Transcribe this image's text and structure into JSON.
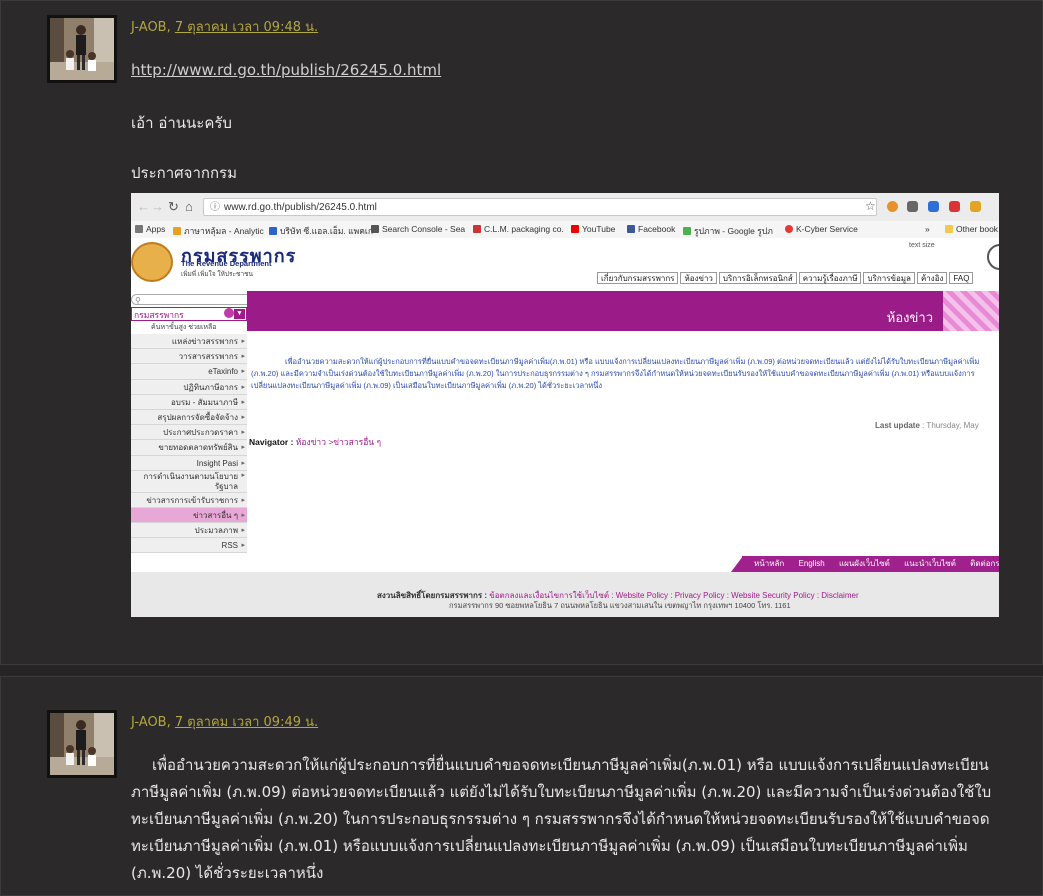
{
  "post1": {
    "author": "J-AOB,",
    "date": "7 ตุลาคม เวลา 09:48 น.",
    "link": "http://www.rd.go.th/publish/26245.0.html",
    "line1": "เอ้า อ่านนะครับ",
    "line2": "ประกาศจากกรม"
  },
  "screenshot": {
    "url": "www.rd.go.th/publish/26245.0.html",
    "bookmarks": [
      "Apps",
      "ภาษาหลุ้มล - Analytic",
      "บริษัท ซี.แอล.เอ็ม. แพคเก",
      "Search Console - Sea",
      "C.L.M. packaging co.",
      "YouTube",
      "Facebook",
      "รูปภาพ - Google รูปภ",
      "K-Cyber Service",
      "»",
      "Other book"
    ],
    "logo_th": "กรมสรรพากร",
    "logo_en": "The Revenue Department",
    "logo_tag": "เพิ่มพี่ เพิ่มใจ ให้ประชาชน",
    "top_icons": "text  size",
    "topnav": [
      "เกี่ยวกับกรมสรรพากร",
      "ห้องข่าว",
      "บริการอิเล็กทรอนิกส์",
      "ความรู้เรื่องภาษี",
      "บริการข้อมูล",
      "ค้างอิง",
      "FAQ"
    ],
    "sidebar_select": "กรมสรรพากร",
    "sidebar_sub": "ค้นหาขั้นสูง   ช่วยเหลือ",
    "menu": [
      "แหล่งข่าวสรรพากร",
      "วารสารสรรพากร",
      "eTaxinfo",
      "ปฏิทินภาษีอากร",
      "อบรม - สัมมนาภาษี",
      "สรุปผลการจัดซื้อจัดจ้าง",
      "ประกาศประกวดราคา",
      "ขายทอดตลาดทรัพย์สิน",
      "Insight Pasi",
      "การดำเนินงานตามนโยบายรัฐบาล",
      "ข่าวสารการเข้ารับราชการ",
      "ข่าวสารอื่น ๆ",
      "ประมวลภาพ",
      "RSS"
    ],
    "banner_title": "ห้องข่าว",
    "content": "เพื่ออำนวยความสะดวกให้แก่ผู้ประกอบการที่ยื่นแบบคำขอจดทะเบียนภาษีมูลค่าเพิ่ม(ภ.พ.01) หรือ แบบแจ้งการเปลี่ยนแปลงทะเบียนภาษีมูลค่าเพิ่ม (ภ.พ.09) ต่อหน่วยจดทะเบียนแล้ว แต่ยังไม่ได้รับใบทะเบียนภาษีมูลค่าเพิ่ม (ภ.พ.20) และมีความจำเป็นเร่งด่วนต้องใช้ใบทะเบียนภาษีมูลค่าเพิ่ม (ภ.พ.20) ในการประกอบธุรกรรมต่าง ๆ กรมสรรพากรจึงได้กำหนดให้หน่วยจดทะเบียนรับรองให้ใช้แบบคำขอจดทะเบียนภาษีมูลค่าเพิ่ม (ภ.พ.01) หรือแบบแจ้งการเปลี่ยนแปลงทะเบียนภาษีมูลค่าเพิ่ม (ภ.พ.09) เป็นเสมือนใบทะเบียนภาษีมูลค่าเพิ่ม (ภ.พ.20) ได้ชั่วระยะเวลาหนึ่ง",
    "last_update_label": "Last update",
    "last_update_value": " : Thursday, May",
    "navigator_label": "Navigator :",
    "navigator_path": " ห้องข่าว >ข่าวสารอื่น ๆ",
    "footer_links": [
      "หน้าหลัก",
      "English",
      "แผนผังเว็บไซต์",
      "แนะนำเว็บไซต์",
      "ติดต่อกรมสรรพ"
    ],
    "footer_copy_label": "สงวนลิขสิทธิ์โดยกรมสรรพากร : ",
    "footer_copy_links": "ข้อตกลงและเงื่อนไขการใช้เว็บไซต์ : Website Policy : Privacy Policy : Website Security Policy : Disclaimer",
    "footer_addr": "กรมสรรพากร 90 ซอยพหลโยธิน 7 ถนนพหลโยธิน แขวงสามเสนใน เขตพญาไท กรุงเทพฯ 10400 โทร. 1161"
  },
  "post2": {
    "author": "J-AOB,",
    "date": "7 ตุลาคม เวลา 09:49 น.",
    "body": "เพื่ออำนวยความสะดวกให้แก่ผู้ประกอบการที่ยื่นแบบคำขอจดทะเบียนภาษีมูลค่าเพิ่ม(ภ.พ.01) หรือ แบบแจ้งการเปลี่ยนแปลงทะเบียนภาษีมูลค่าเพิ่ม (ภ.พ.09) ต่อหน่วยจดทะเบียนแล้ว แต่ยังไม่ได้รับใบทะเบียนภาษีมูลค่าเพิ่ม (ภ.พ.20) และมีความจำเป็นเร่งด่วนต้องใช้ใบทะเบียนภาษีมูลค่าเพิ่ม (ภ.พ.20) ในการประกอบธุรกรรมต่าง ๆ กรมสรรพากรจึงได้กำหนดให้หน่วยจดทะเบียนรับรองให้ใช้แบบคำขอจดทะเบียนภาษีมูลค่าเพิ่ม (ภ.พ.01) หรือแบบแจ้งการเปลี่ยนแปลงทะเบียนภาษีมูลค่าเพิ่ม (ภ.พ.09) เป็นเสมือนใบทะเบียนภาษีมูลค่าเพิ่ม (ภ.พ.20) ได้ชั่วระยะเวลาหนึ่ง"
  },
  "colors": {
    "background": "#262424",
    "author": "#b4a640",
    "site_accent": "#9b1b89"
  }
}
